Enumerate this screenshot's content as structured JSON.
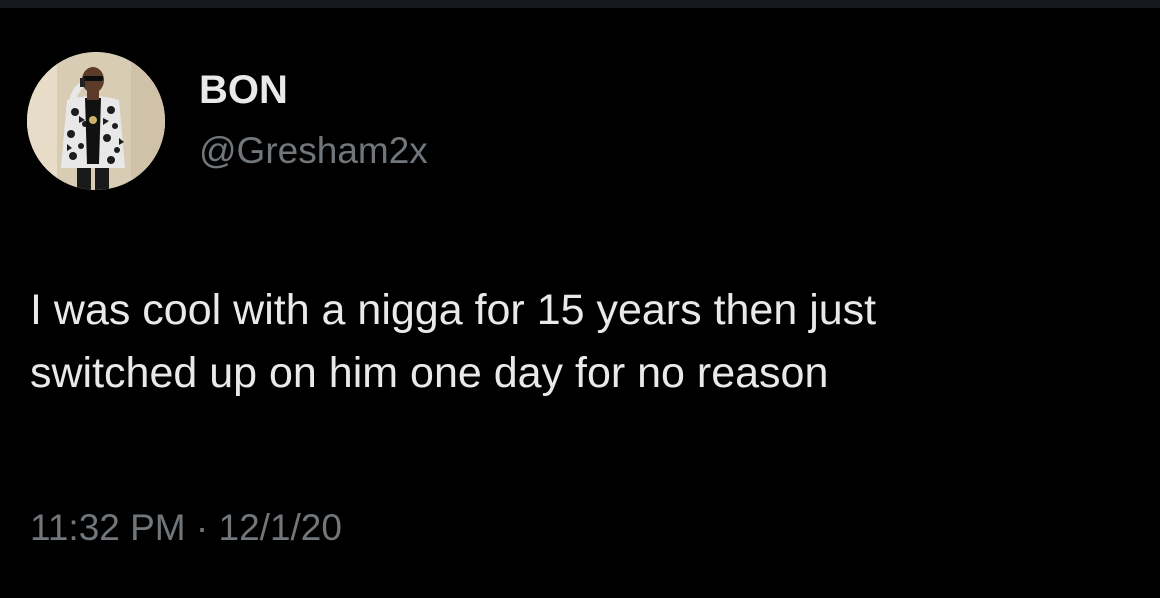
{
  "tweet": {
    "display_name": "BON",
    "handle": "@Gresham2x",
    "text_lines": [
      "I was cool with a nigga for 15 years then just",
      "switched up on him one day for no reason"
    ],
    "time": "11:32 PM",
    "separator": "·",
    "date": "12/1/20",
    "avatar_icon": "profile-photo"
  },
  "colors": {
    "background": "#000000",
    "primary_text": "#e7e9ea",
    "secondary_text": "#71767b"
  }
}
